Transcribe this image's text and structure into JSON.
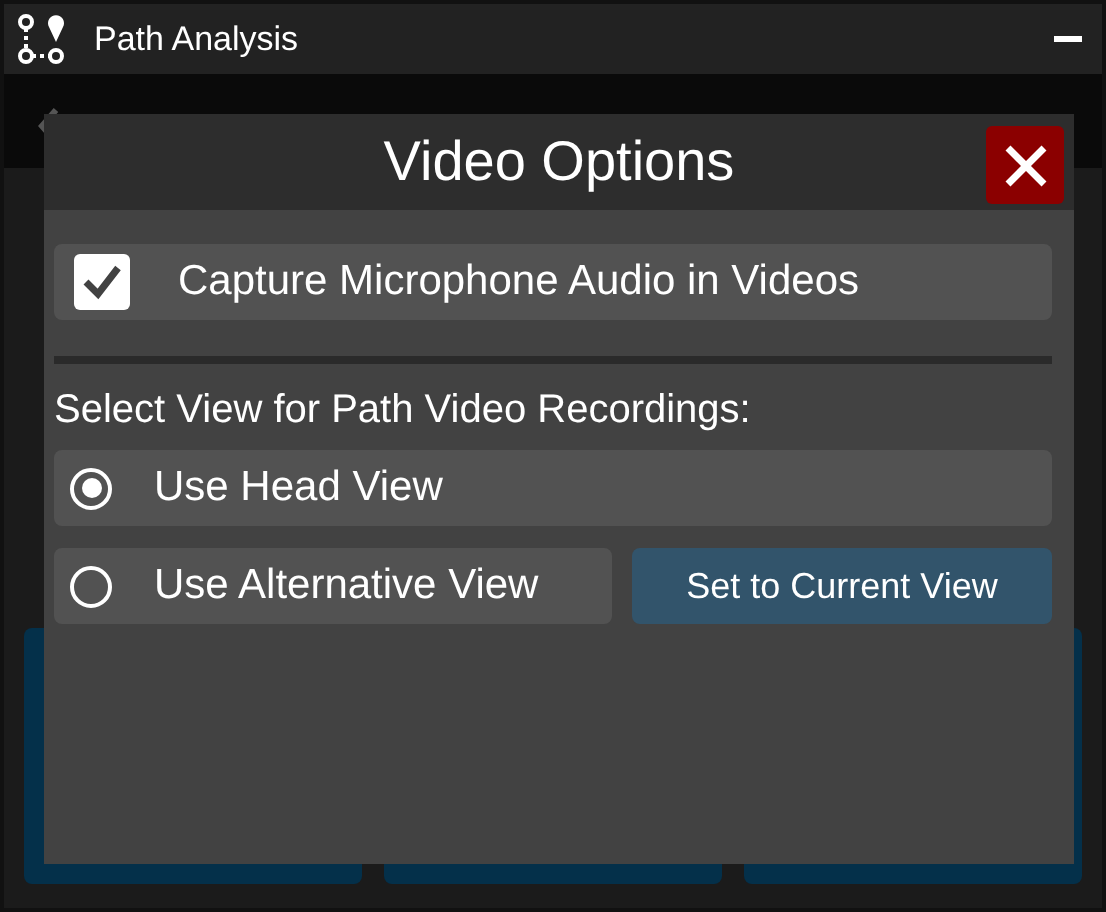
{
  "window": {
    "title": "Path Analysis"
  },
  "dialog": {
    "title": "Video Options",
    "audio": {
      "label": "Capture Microphone Audio in Videos",
      "checked": true
    },
    "view_label": "Select View for Path Video Recordings:",
    "views": [
      {
        "label": "Use Head View",
        "selected": true
      },
      {
        "label": "Use Alternative View",
        "selected": false
      }
    ],
    "set_button": "Set to Current View"
  }
}
